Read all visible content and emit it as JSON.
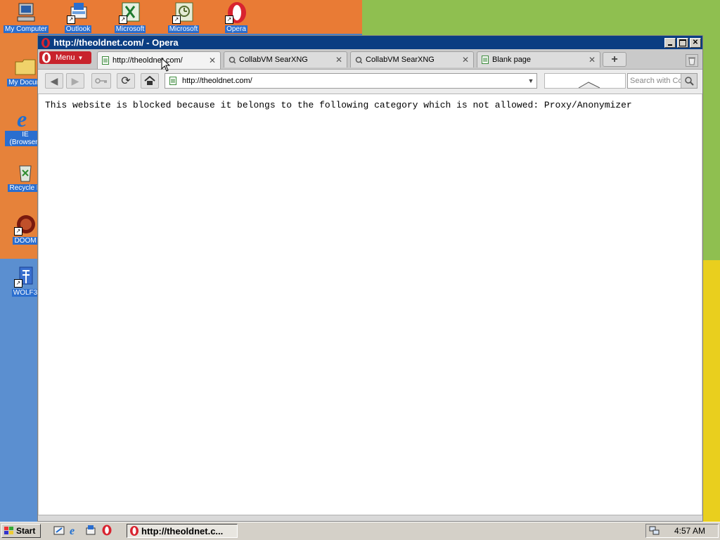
{
  "desktop": {
    "icons": [
      {
        "label": "My Computer"
      },
      {
        "label": "Outlook"
      },
      {
        "label": "Microsoft"
      },
      {
        "label": "Microsoft"
      },
      {
        "label": "Opera"
      },
      {
        "label": "My Docum"
      },
      {
        "label": "IE (Browserv"
      },
      {
        "label": "Recycle B"
      },
      {
        "label": "DOOM"
      },
      {
        "label": "WOLF3"
      }
    ]
  },
  "window": {
    "title": "http://theoldnet.com/ - Opera",
    "menu_label": "Menu",
    "tabs": [
      {
        "label": "http://theoldnet.com/",
        "active": true
      },
      {
        "label": "CollabVM SearXNG",
        "active": false
      },
      {
        "label": "CollabVM SearXNG",
        "active": false
      },
      {
        "label": "Blank page",
        "active": false
      }
    ],
    "new_tab_label": "+",
    "address_value": "http://theoldnet.com/",
    "search_placeholder": "Search with Co",
    "page_message": "This website is blocked because it belongs to the following category which is not allowed: Proxy/Anonymizer"
  },
  "taskbar": {
    "start_label": "Start",
    "task_label": "http://theoldnet.c...",
    "clock": "4:57 AM"
  },
  "colors": {
    "titlebar": "#0a3d82",
    "menu_button": "#c8232c",
    "opera_red": "#d8232f"
  }
}
